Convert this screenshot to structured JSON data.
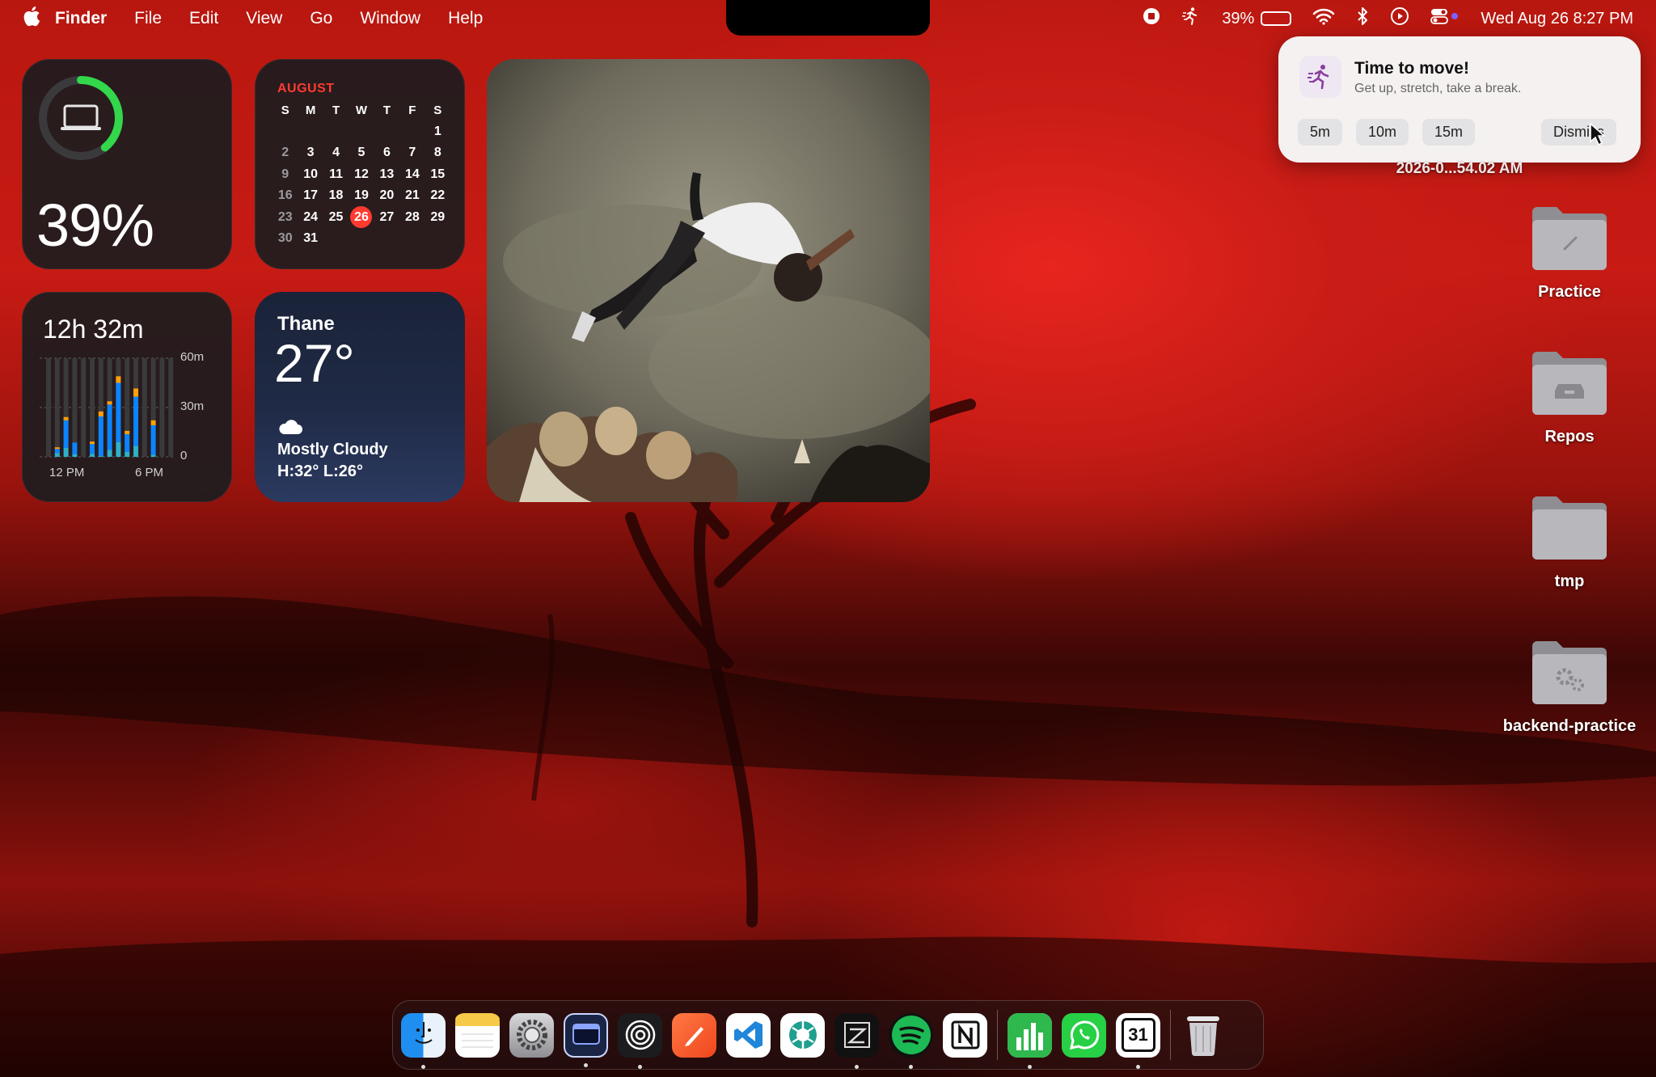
{
  "menubar": {
    "app_name": "Finder",
    "items": [
      "File",
      "Edit",
      "View",
      "Go",
      "Window",
      "Help"
    ],
    "battery_percent": "39%",
    "battery_level": 0.39,
    "datetime": "Wed Aug 26  8:27 PM"
  },
  "widgets": {
    "battery": {
      "percent": "39%",
      "level": 0.39
    },
    "calendar": {
      "month": "AUGUST",
      "weekdays": [
        "S",
        "M",
        "T",
        "W",
        "T",
        "F",
        "S"
      ],
      "today": "26",
      "days": [
        "",
        "",
        "",
        "",
        "",
        "",
        "1",
        "2",
        "3",
        "4",
        "5",
        "6",
        "7",
        "8",
        "9",
        "10",
        "11",
        "12",
        "13",
        "14",
        "15",
        "16",
        "17",
        "18",
        "19",
        "20",
        "21",
        "22",
        "23",
        "24",
        "25",
        "26",
        "27",
        "28",
        "29",
        "30",
        "31",
        "",
        "",
        "",
        "",
        ""
      ]
    },
    "screen_time": {
      "total": "12h 32m",
      "y_labels": [
        "60m",
        "30m",
        "0"
      ],
      "x_labels": [
        "12 PM",
        "6 PM"
      ]
    },
    "weather": {
      "city": "Thane",
      "temp": "27°",
      "condition": "Mostly Cloudy",
      "high_low": "H:32° L:26°"
    }
  },
  "notification": {
    "title": "Time to move!",
    "body": "Get up, stretch, take a break.",
    "buttons": {
      "b5": "5m",
      "b10": "10m",
      "b15": "15m",
      "dismiss": "Dismiss"
    }
  },
  "desktop": {
    "top_file": "2026-0...54.02 AM",
    "folders": [
      "Practice",
      "Repos",
      "tmp",
      "backend-practice"
    ]
  },
  "dock": {
    "apps": [
      "Finder",
      "Notes",
      "System Settings",
      "Terminal",
      "Arc",
      "Swift Playgrounds",
      "Visual Studio Code",
      "ChatGPT",
      "Zed",
      "Spotify",
      "Notion",
      "Numbers",
      "WhatsApp",
      "Notion Calendar",
      "Trash"
    ],
    "calendar_day": "31"
  },
  "colors": {
    "accent_red": "#ff3b30",
    "battery_green": "#32d74b",
    "screen_time_blue": "#0a84ff",
    "screen_time_teal": "#30b0c7",
    "screen_time_orange": "#ff9f0a"
  }
}
